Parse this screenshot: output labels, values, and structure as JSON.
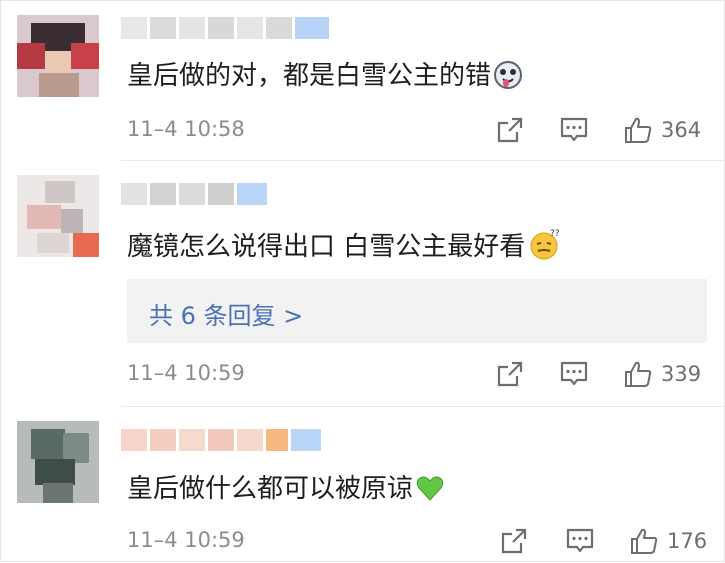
{
  "comments": [
    {
      "text": "皇后做的对，都是白雪公主的错",
      "emoji": "drooling-face-emoji",
      "time": "11–4 10:58",
      "likes": "364"
    },
    {
      "text": "魔镜怎么说得出口 白雪公主最好看",
      "emoji": "confused-face-emoji",
      "time": "11–4 10:59",
      "likes": "339",
      "replies_label": "共 6 条回复 >"
    },
    {
      "text": "皇后做什么都可以被原谅",
      "emoji": "green-heart-emoji",
      "time": "11–4 10:59",
      "likes": "176"
    }
  ],
  "colors": {
    "reply_link": "#4a71b6",
    "timestamp": "#8c8c8c",
    "divider": "#e8e8e8",
    "replies_bg": "#f2f2f2"
  }
}
